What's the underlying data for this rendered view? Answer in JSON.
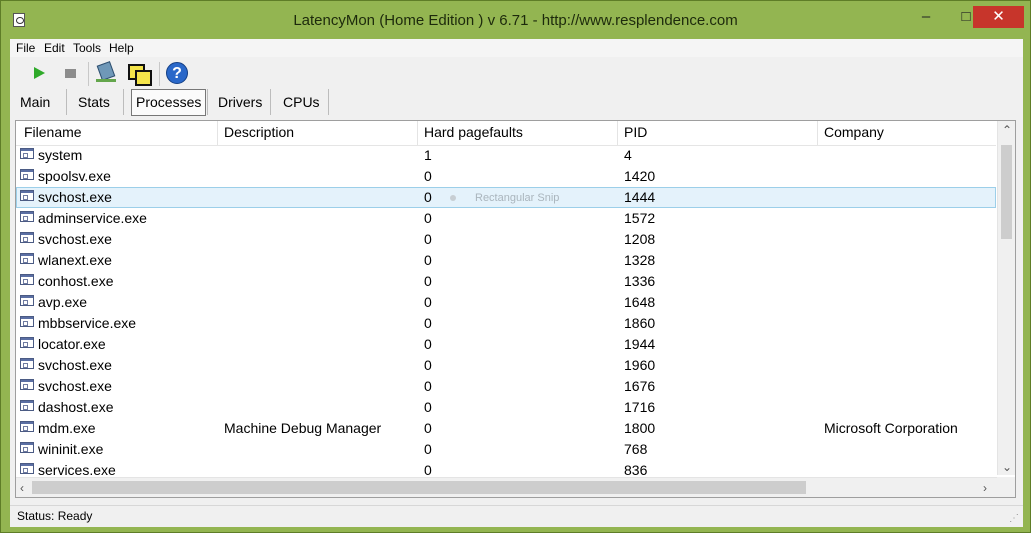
{
  "window": {
    "title": "LatencyMon  (Home Edition )  v 6.71 - http://www.resplendence.com",
    "controls": {
      "minimize": "–",
      "maximize": "□",
      "close": "✕"
    }
  },
  "menu": {
    "file": "File",
    "edit": "Edit",
    "tools": "Tools",
    "help": "Help"
  },
  "toolbar": {
    "icons": [
      "play-icon",
      "stop-icon",
      "tools-icon",
      "windows-icon",
      "help-icon"
    ]
  },
  "tabs": [
    {
      "label": "Main"
    },
    {
      "label": "Stats"
    },
    {
      "label": "Processes",
      "active": true
    },
    {
      "label": "Drivers"
    },
    {
      "label": "CPUs"
    }
  ],
  "table": {
    "columns": [
      "Filename",
      "Description",
      "Hard pagefaults",
      "PID",
      "Company"
    ],
    "rows": [
      {
        "filename": "system",
        "description": "",
        "hard_pagefaults": "1",
        "pid": "4",
        "company": ""
      },
      {
        "filename": "spoolsv.exe",
        "description": "",
        "hard_pagefaults": "0",
        "pid": "1420",
        "company": ""
      },
      {
        "filename": "svchost.exe",
        "description": "",
        "hard_pagefaults": "0",
        "pid": "1444",
        "company": ""
      },
      {
        "filename": "adminservice.exe",
        "description": "",
        "hard_pagefaults": "0",
        "pid": "1572",
        "company": ""
      },
      {
        "filename": "svchost.exe",
        "description": "",
        "hard_pagefaults": "0",
        "pid": "1208",
        "company": ""
      },
      {
        "filename": "wlanext.exe",
        "description": "",
        "hard_pagefaults": "0",
        "pid": "1328",
        "company": ""
      },
      {
        "filename": "conhost.exe",
        "description": "",
        "hard_pagefaults": "0",
        "pid": "1336",
        "company": ""
      },
      {
        "filename": "avp.exe",
        "description": "",
        "hard_pagefaults": "0",
        "pid": "1648",
        "company": ""
      },
      {
        "filename": "mbbservice.exe",
        "description": "",
        "hard_pagefaults": "0",
        "pid": "1860",
        "company": ""
      },
      {
        "filename": "locator.exe",
        "description": "",
        "hard_pagefaults": "0",
        "pid": "1944",
        "company": ""
      },
      {
        "filename": "svchost.exe",
        "description": "",
        "hard_pagefaults": "0",
        "pid": "1960",
        "company": ""
      },
      {
        "filename": "svchost.exe",
        "description": "",
        "hard_pagefaults": "0",
        "pid": "1676",
        "company": ""
      },
      {
        "filename": "dashost.exe",
        "description": "",
        "hard_pagefaults": "0",
        "pid": "1716",
        "company": ""
      },
      {
        "filename": "mdm.exe",
        "description": "Machine Debug Manager",
        "hard_pagefaults": "0",
        "pid": "1800",
        "company": "Microsoft Corporation"
      },
      {
        "filename": "wininit.exe",
        "description": "",
        "hard_pagefaults": "0",
        "pid": "768",
        "company": ""
      },
      {
        "filename": "services.exe",
        "description": "",
        "hard_pagefaults": "0",
        "pid": "836",
        "company": ""
      }
    ]
  },
  "overlay": {
    "snip_tooltip": "Rectangular Snip"
  },
  "status": {
    "text": "Status: Ready"
  }
}
